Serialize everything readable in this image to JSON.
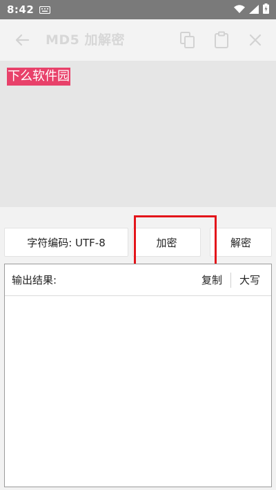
{
  "status_bar": {
    "time": "8:42",
    "icons": [
      "keyboard-icon",
      "wifi-icon",
      "signal-icon",
      "battery-charging-icon"
    ]
  },
  "toolbar": {
    "title": "MD5 加解密",
    "icons": [
      "back-arrow-icon",
      "copy-icon",
      "clipboard-icon",
      "close-icon"
    ]
  },
  "input": {
    "text": "下么软件园",
    "highlight_color": "#e8416a"
  },
  "buttons": {
    "charset_label": "字符编码: UTF-8",
    "encrypt_label": "加密",
    "decrypt_label": "解密"
  },
  "output": {
    "label": "输出结果:",
    "copy_label": "复制",
    "uppercase_label": "大写",
    "value": ""
  },
  "annotation": {
    "highlight_color": "#e3141a"
  }
}
